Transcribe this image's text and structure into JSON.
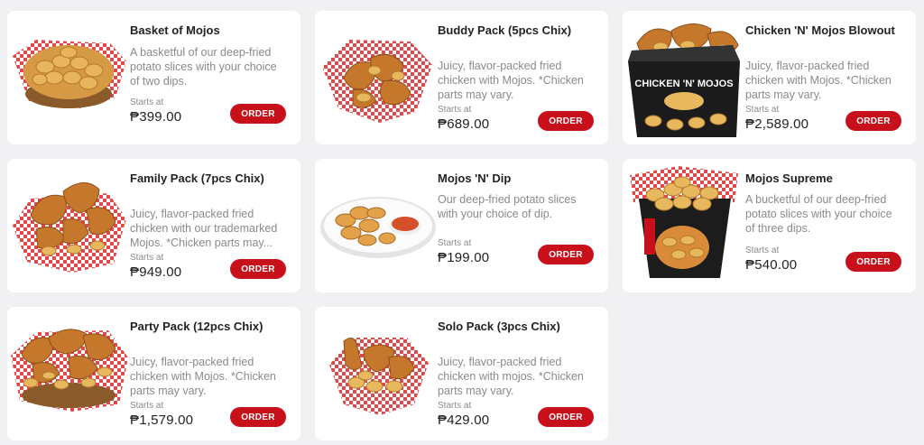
{
  "currency_symbol": "₱",
  "products": [
    {
      "title": "Basket of Mojos",
      "description": "A basketful of our deep-fried potato slices with your choice of two dips.",
      "starts_label": "Starts at",
      "price": "₱399.00",
      "order_label": "ORDER",
      "image_icon": "mojos-basket-image"
    },
    {
      "title": "Buddy Pack (5pcs Chix)",
      "description": "Juicy, flavor-packed fried chicken with Mojos. *Chicken parts may vary.",
      "starts_label": "Starts at",
      "price": "₱689.00",
      "order_label": "ORDER",
      "image_icon": "chicken-basket-image"
    },
    {
      "title": "Chicken 'N' Mojos Blowout",
      "description": "Juicy, flavor-packed fried chicken with Mojos. *Chicken parts may vary.",
      "starts_label": "Starts at",
      "price": "₱2,589.00",
      "order_label": "ORDER",
      "image_icon": "blowout-box-image",
      "image_text": "CHICKEN 'N' MOJOS"
    },
    {
      "title": "Family Pack (7pcs Chix)",
      "description": "Juicy, flavor-packed fried chicken with our trademarked Mojos. *Chicken parts may...",
      "starts_label": "Starts at",
      "price": "₱949.00",
      "order_label": "ORDER",
      "image_icon": "chicken-basket-image"
    },
    {
      "title": "Mojos 'N' Dip",
      "description": "Our deep-fried potato slices with your choice of dip.",
      "starts_label": "Starts at",
      "price": "₱199.00",
      "order_label": "ORDER",
      "image_icon": "mojos-plate-image"
    },
    {
      "title": "Mojos Supreme",
      "description": "A bucketful of our deep-fried potato slices with your choice of three dips.",
      "starts_label": "Starts at",
      "price": "₱540.00",
      "order_label": "ORDER",
      "image_icon": "mojos-bucket-image"
    },
    {
      "title": "Party Pack (12pcs Chix)",
      "description": "Juicy, flavor-packed fried chicken with Mojos. *Chicken parts may vary.",
      "starts_label": "Starts at",
      "price": "₱1,579.00",
      "order_label": "ORDER",
      "image_icon": "chicken-basket-image"
    },
    {
      "title": "Solo Pack (3pcs Chix)",
      "description": "Juicy, flavor-packed fried chicken with mojos. *Chicken parts may vary.",
      "starts_label": "Starts at",
      "price": "₱429.00",
      "order_label": "ORDER",
      "image_icon": "chicken-basket-image"
    }
  ],
  "colors": {
    "background": "#f1f1f3",
    "card": "#ffffff",
    "order_button": "#c8101a",
    "title_text": "#222222",
    "description_text": "#8a8a8a"
  }
}
